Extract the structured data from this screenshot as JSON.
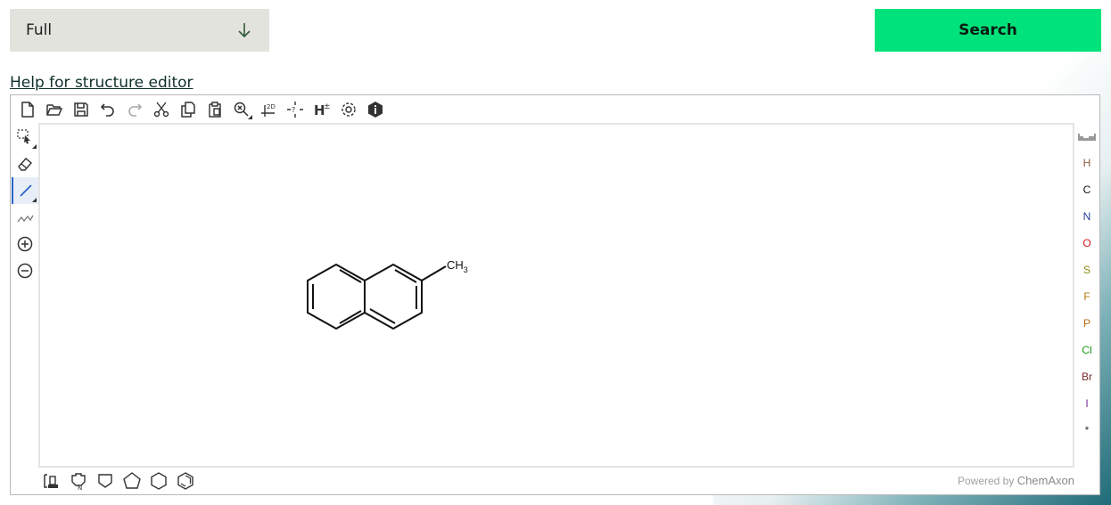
{
  "select": {
    "value": "Full"
  },
  "search_button": {
    "label": "Search"
  },
  "help_link": {
    "label": "Help for structure editor"
  },
  "editor": {
    "molecule_label": {
      "main": "CH",
      "subscript": "3"
    },
    "elements": [
      {
        "symbol": "H",
        "color": "#8a5a3a"
      },
      {
        "symbol": "C",
        "color": "#111111"
      },
      {
        "symbol": "N",
        "color": "#2b3a9a"
      },
      {
        "symbol": "O",
        "color": "#d01a1a"
      },
      {
        "symbol": "S",
        "color": "#8a8a10"
      },
      {
        "symbol": "F",
        "color": "#b07a10"
      },
      {
        "symbol": "P",
        "color": "#c06a10"
      },
      {
        "symbol": "Cl",
        "color": "#1a9a1a"
      },
      {
        "symbol": "Br",
        "color": "#7a2a2a"
      },
      {
        "symbol": "I",
        "color": "#7a2a9a"
      },
      {
        "symbol": "*",
        "color": "#333333"
      }
    ],
    "powered_by": "Powered by",
    "brand": "ChemAxon"
  },
  "colors": {
    "search_green": "#00e37b",
    "select_bg": "#e3e3de",
    "active_tool": "#2a63c8"
  }
}
